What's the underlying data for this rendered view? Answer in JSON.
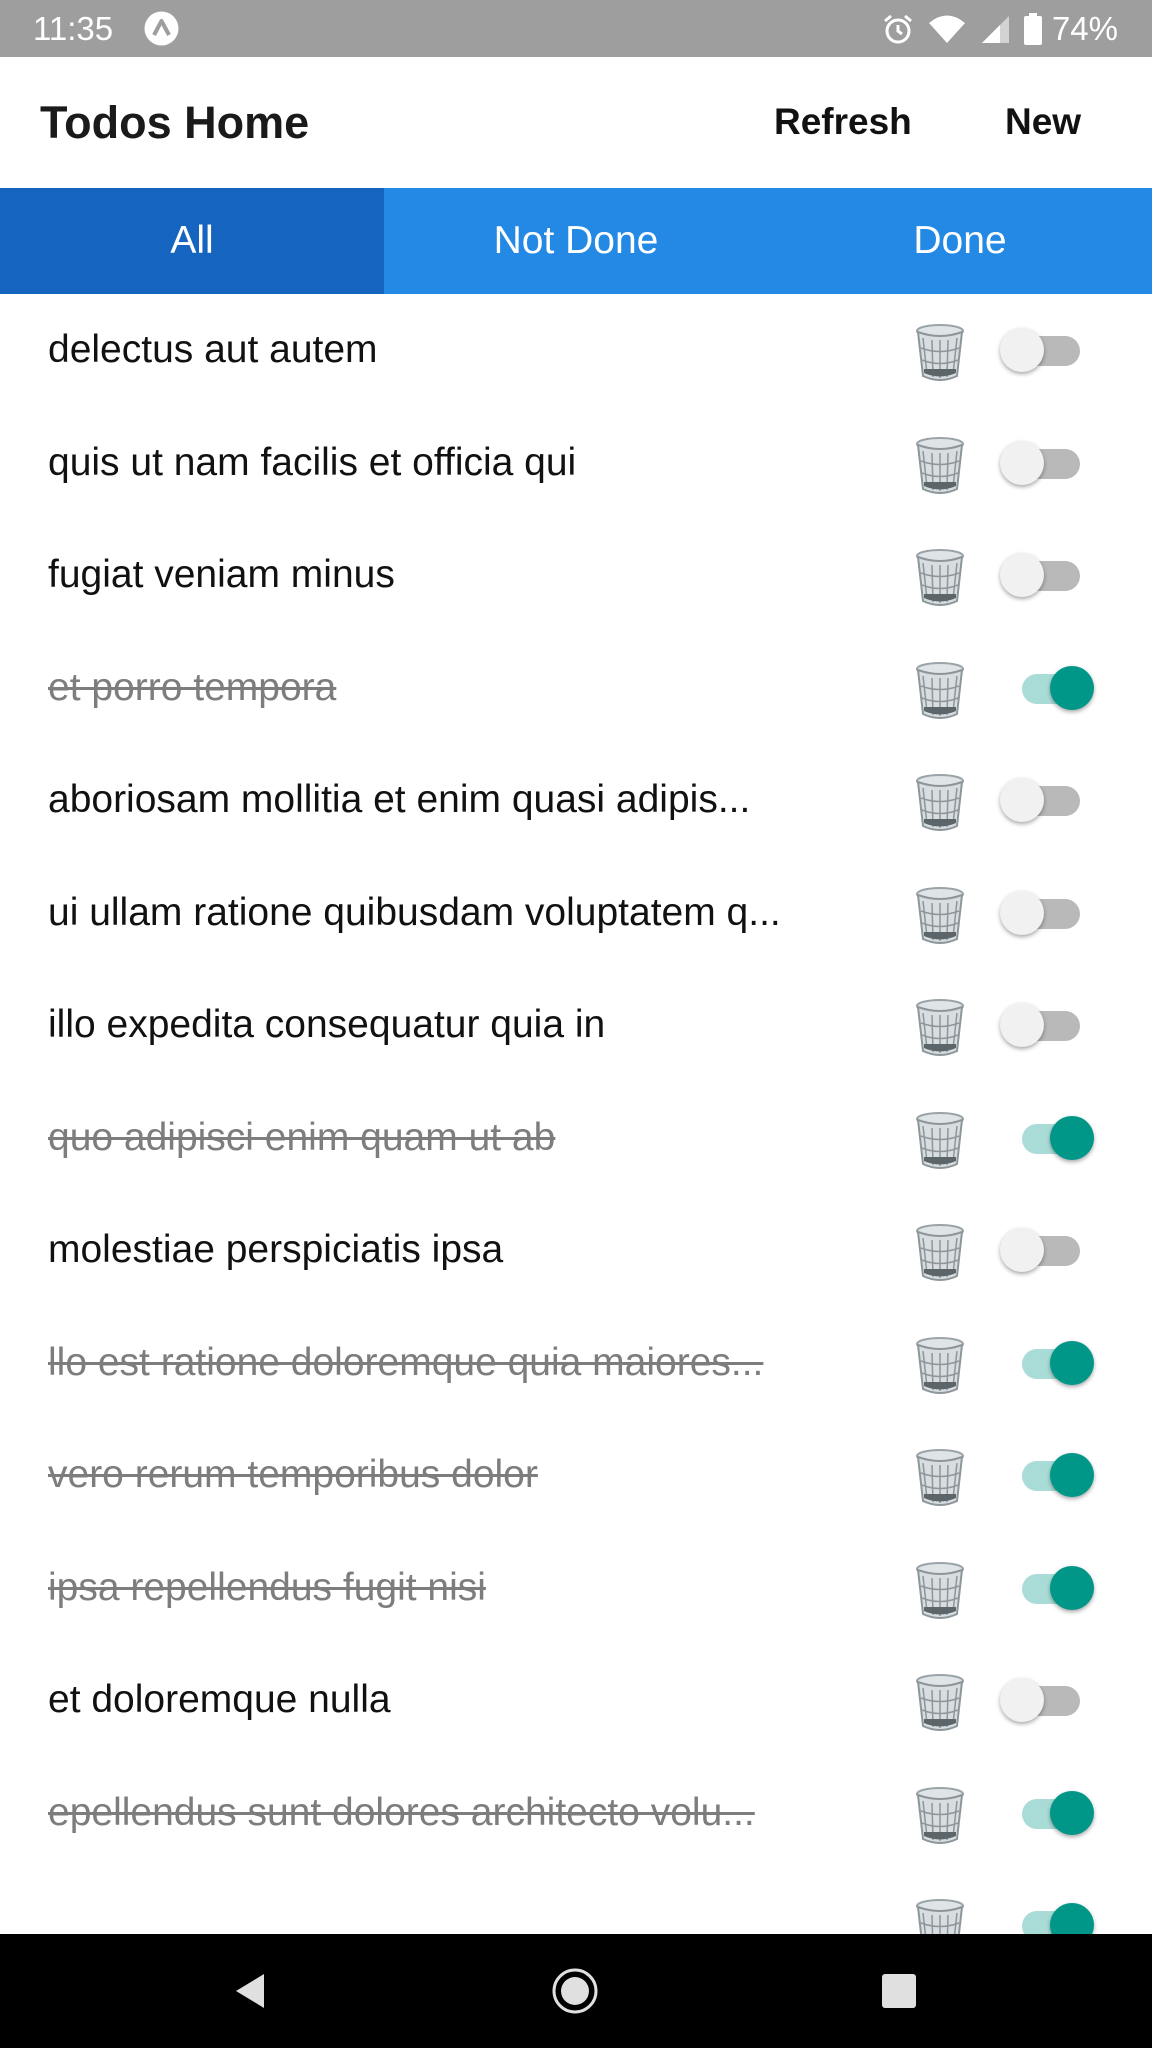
{
  "status_bar": {
    "time": "11:35",
    "battery_percent": "74%",
    "icons": [
      "app-notification-icon",
      "alarm-icon",
      "wifi-icon",
      "cell-signal-icon",
      "battery-icon"
    ]
  },
  "app_bar": {
    "title": "Todos Home",
    "refresh_label": "Refresh",
    "new_label": "New"
  },
  "tabs": [
    {
      "label": "All",
      "active": true
    },
    {
      "label": "Not Done",
      "active": false
    },
    {
      "label": "Done",
      "active": false
    }
  ],
  "todos": [
    {
      "title": "delectus aut autem",
      "done": false
    },
    {
      "title": "quis ut nam facilis et officia qui",
      "done": false
    },
    {
      "title": "fugiat veniam minus",
      "done": false
    },
    {
      "title": "et porro tempora",
      "done": true
    },
    {
      "title": "aboriosam mollitia et enim quasi adipis...",
      "done": false
    },
    {
      "title": "ui ullam ratione quibusdam voluptatem q...",
      "done": false
    },
    {
      "title": "illo expedita consequatur quia in",
      "done": false
    },
    {
      "title": "quo adipisci enim quam ut ab",
      "done": true
    },
    {
      "title": "molestiae perspiciatis ipsa",
      "done": false
    },
    {
      "title": "llo est ratione doloremque quia maiores...",
      "done": true
    },
    {
      "title": "vero rerum temporibus dolor",
      "done": true
    },
    {
      "title": "ipsa repellendus fugit nisi",
      "done": true
    },
    {
      "title": "et doloremque nulla",
      "done": false
    },
    {
      "title": "epellendus sunt dolores architecto volu...",
      "done": true
    },
    {
      "title": "",
      "done": true
    }
  ],
  "colors": {
    "status_bar": "#9e9e9e",
    "tab_bar": "#2389e5",
    "tab_active": "#1565c0",
    "switch_on": "#009688",
    "switch_on_track": "#aadcd7",
    "switch_off_track": "#b9b9b9",
    "done_text": "#7d7d7d"
  },
  "icons": {
    "row_delete": "trash-can-icon",
    "nav": [
      "back-icon",
      "home-icon",
      "recents-icon"
    ]
  }
}
